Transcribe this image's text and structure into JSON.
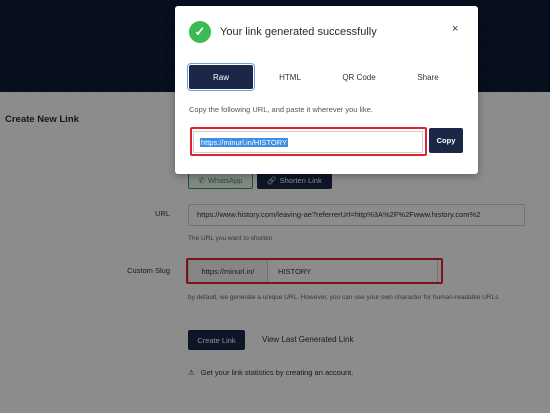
{
  "page": {
    "create_title": "Create New Link",
    "share": {
      "whatsapp_label": "WhatsApp",
      "shorten_label": "Shorten Link"
    },
    "url": {
      "label": "URL",
      "value": "https://www.history.com/leaving-ae?referrerUrl=http%3A%2F%2Fwww.history.com%2",
      "hint": "The URL you want to shorten"
    },
    "slug": {
      "label": "Custom Slug",
      "prefix": "https://minurl.in/",
      "value": "HISTORY",
      "hint": "by default, we generate a unique URL. However, you can use your own character for human-readable URLs"
    },
    "create_button": "Create Link",
    "view_last": "View Last Generated Link",
    "stats_text": "Get your link statistics by",
    "stats_link": "creating an account."
  },
  "modal": {
    "title": "Your link generated successfully",
    "close": "×",
    "tabs": [
      "Raw",
      "HTML",
      "QR Code",
      "Share"
    ],
    "active_tab": "Raw",
    "instruction": "Copy the following URL, and paste it wherever you like.",
    "generated_url": "https://minurl.in/HISTORY",
    "copy_label": "Copy"
  },
  "colors": {
    "accent": "#1a2747",
    "success": "#3cba54",
    "highlight": "#e0242f"
  }
}
